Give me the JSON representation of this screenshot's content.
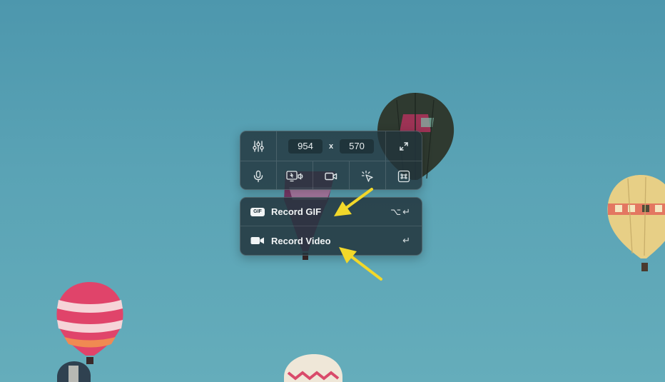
{
  "toolbar": {
    "width_value": "954",
    "times_symbol": "x",
    "height_value": "570",
    "icons": [
      "sliders-icon",
      "expand-icon",
      "microphone-icon",
      "system-audio-icon",
      "camera-icon",
      "click-highlight-icon",
      "keystroke-icon"
    ]
  },
  "menu": {
    "items": [
      {
        "badge": "GIF",
        "label": "Record GIF",
        "shortcut": "⌥↵",
        "icon": "gif-icon"
      },
      {
        "label": "Record Video",
        "shortcut": "↵",
        "icon": "video-camera-icon"
      }
    ]
  },
  "colors": {
    "sky": "#5aa3b5",
    "panel": "#22343c",
    "arrow": "#f2d82a"
  }
}
